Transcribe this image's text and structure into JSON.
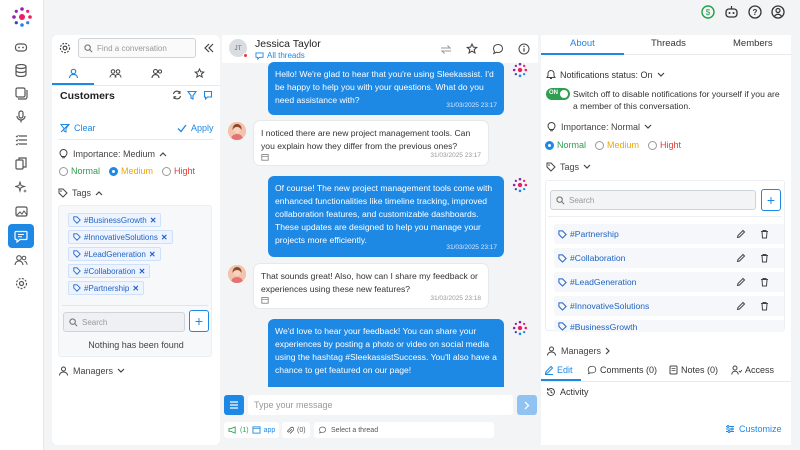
{
  "topbar": {
    "icons": [
      "dollar-icon",
      "robot-icon",
      "help-icon",
      "user-menu-icon"
    ]
  },
  "rail": {
    "items": [
      "bot-icon",
      "database-icon",
      "gallery-icon",
      "mic-icon",
      "list-icon",
      "copy-icon",
      "sparkle-icon",
      "image-icon",
      "chat-icon",
      "users-icon",
      "settings-icon"
    ],
    "active": "chat-icon"
  },
  "customers": {
    "search_placeholder": "Find a conversation",
    "title": "Customers",
    "clear_label": "Clear",
    "apply_label": "Apply",
    "importance_label": "Importance: Medium",
    "importance_options": [
      "Normal",
      "Medium",
      "Hight"
    ],
    "importance_selected": "Medium",
    "tags_label": "Tags",
    "tags": [
      "#BusinessGrowth",
      "#InnovativeSolutions",
      "#LeadGeneration",
      "#Collaboration",
      "#Partnership"
    ],
    "tag_search_placeholder": "Search",
    "empty_text": "Nothing has been found",
    "managers_label": "Managers",
    "colors": {
      "normal": "#2e9e4f",
      "medium": "#f0a500",
      "hight": "#e53935",
      "accent": "#1e88e5"
    }
  },
  "chat": {
    "contact_name": "Jessica Taylor",
    "contact_initials": "JT",
    "threads_link": "All threads",
    "messages": [
      {
        "from": "bot",
        "text": "Hello! We're glad to hear that you're using Sleekassist. I'd be happy to help you with your questions. What do you need assistance with?",
        "time": "31/03/2025 23:17"
      },
      {
        "from": "user",
        "text": "I noticed there are new project management tools. Can you explain how they differ from the previous ones?",
        "time": "31/03/2025 23:17"
      },
      {
        "from": "bot",
        "text": "Of course! The new project management tools come with enhanced functionalities like timeline tracking, improved collaboration features, and customizable dashboards. These updates are designed to help you manage your projects more efficiently.",
        "time": "31/03/2025 23:17"
      },
      {
        "from": "user",
        "text": "That sounds great! Also, how can I share my feedback or experiences using these new features?",
        "time": "31/03/2025 23:18"
      },
      {
        "from": "bot",
        "text": "We'd love to hear your feedback! You can share your experiences by posting a photo or video on social media using the hashtag #SleekassistSuccess. You'll also have a chance to get featured on our page!",
        "time": ""
      }
    ],
    "composer_placeholder": "Type your message",
    "footer": {
      "channel_count": "(1)",
      "channel_label": "app",
      "attachment_count": "(0)",
      "thread_label": "Select a thread"
    }
  },
  "details": {
    "tabs": [
      "About",
      "Threads",
      "Members"
    ],
    "active_tab": "About",
    "notifications_label": "Notifications status: On",
    "toggle_label": "ON",
    "toggle_text": "Switch off to disable notifications for yourself if you are a member of this conversation.",
    "importance_label": "Importance: Normal",
    "importance_options": [
      "Normal",
      "Medium",
      "Hight"
    ],
    "importance_selected": "Normal",
    "tags_label": "Tags",
    "tag_search_placeholder": "Search",
    "tags": [
      "#Partnership",
      "#Collaboration",
      "#LeadGeneration",
      "#InnovativeSolutions",
      "#BusinessGrowth"
    ],
    "managers_label": "Managers",
    "bottom_tabs": [
      "Edit",
      "Comments (0)",
      "Notes (0)",
      "Access"
    ],
    "activity_label": "Activity",
    "customize_label": "Customize"
  }
}
